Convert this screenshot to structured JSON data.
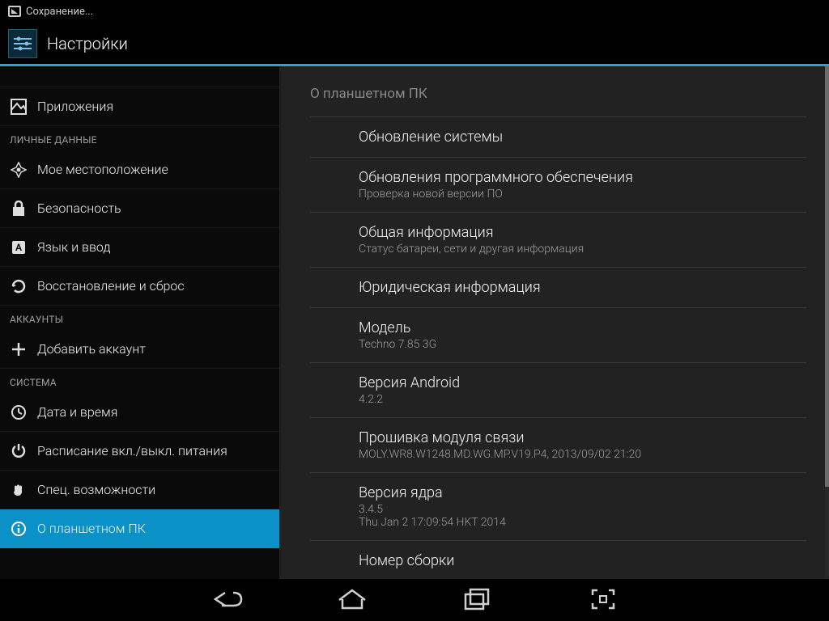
{
  "statusbar": {
    "text": "Сохранение..."
  },
  "appbar": {
    "title": "Настройки"
  },
  "sidebar": {
    "items": [
      {
        "label": ""
      },
      {
        "label": "Приложения"
      }
    ],
    "cat_personal": "ЛИЧНЫЕ ДАННЫЕ",
    "personal": [
      {
        "label": "Мое местоположение"
      },
      {
        "label": "Безопасность"
      },
      {
        "label": "Язык и ввод"
      },
      {
        "label": "Восстановление и сброс"
      }
    ],
    "cat_accounts": "АККАУНТЫ",
    "accounts": [
      {
        "label": "Добавить аккаунт"
      }
    ],
    "cat_system": "СИСТЕМА",
    "system": [
      {
        "label": "Дата и время"
      },
      {
        "label": "Расписание вкл./выкл. питания"
      },
      {
        "label": "Спец. возможности"
      },
      {
        "label": "О планшетном ПК"
      }
    ]
  },
  "detail": {
    "header": "О планшетном ПК",
    "items": [
      {
        "title": "Обновление системы",
        "sub": ""
      },
      {
        "title": "Обновления программного обеспечения",
        "sub": "Проверка новой версии ПО"
      },
      {
        "title": "Общая информация",
        "sub": "Статус батареи, сети и другая информация"
      },
      {
        "title": "Юридическая информация",
        "sub": ""
      },
      {
        "title": "Модель",
        "sub": "Techno 7.85 3G"
      },
      {
        "title": "Версия Android",
        "sub": "4.2.2"
      },
      {
        "title": "Прошивка модуля связи",
        "sub": "MOLY.WR8.W1248.MD.WG.MP.V19.P4, 2013/09/02 21:20"
      },
      {
        "title": "Версия ядра",
        "sub": "3.4.5\nThu Jan 2 17:09:54 HKT 2014"
      },
      {
        "title": "Номер сборки",
        "sub": ""
      }
    ]
  }
}
